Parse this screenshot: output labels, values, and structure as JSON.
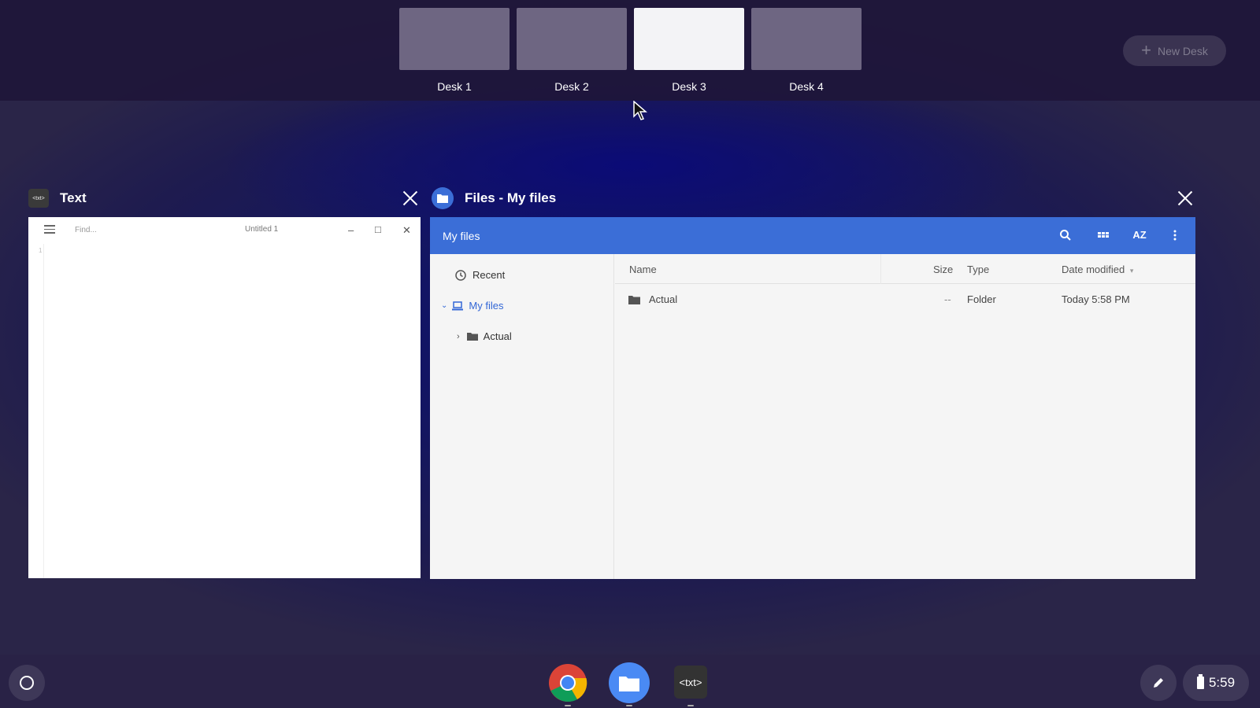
{
  "desks": {
    "items": [
      {
        "label": "Desk 1"
      },
      {
        "label": "Desk 2"
      },
      {
        "label": "Desk 3"
      },
      {
        "label": "Desk 4"
      }
    ],
    "active": "Desk 3",
    "new_desk_label": "New Desk"
  },
  "text_window": {
    "title": "Text",
    "app_icon_label": "<txt>",
    "find_placeholder": "Find...",
    "document_title": "Untitled 1",
    "line_number": "1"
  },
  "files_window": {
    "title": "Files - My files",
    "location": "My files",
    "sidebar": {
      "recent": "Recent",
      "my_files": "My files",
      "actual": "Actual"
    },
    "columns": {
      "name": "Name",
      "size": "Size",
      "type": "Type",
      "date_modified": "Date modified"
    },
    "rows": [
      {
        "name": "Actual",
        "size": "--",
        "type": "Folder",
        "date": "Today 5:58 PM"
      }
    ]
  },
  "shelf": {
    "apps": [
      "chrome-icon",
      "files-icon",
      "text-app-icon"
    ],
    "text_app_label": "<txt>",
    "time": "5:59"
  },
  "colors": {
    "files_accent": "#3b6ed7",
    "selected_nav": "#3367d6"
  }
}
